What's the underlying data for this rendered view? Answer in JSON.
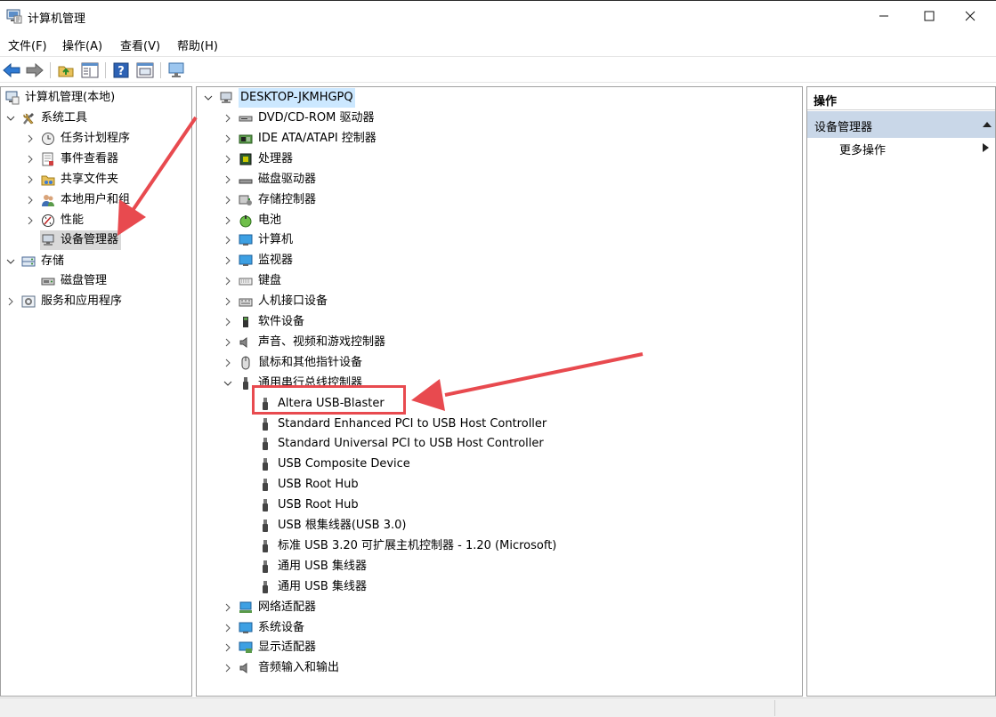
{
  "window": {
    "title": "计算机管理",
    "minimize_glyph": "—",
    "maximize_glyph": "☐",
    "close_glyph": "✕"
  },
  "menu": [
    "文件(F)",
    "操作(A)",
    "查看(V)",
    "帮助(H)"
  ],
  "left_tree": {
    "root": "计算机管理(本地)",
    "system_tools": "系统工具",
    "task_scheduler": "任务计划程序",
    "event_viewer": "事件查看器",
    "shared_folders": "共享文件夹",
    "local_users": "本地用户和组",
    "performance": "性能",
    "device_manager": "设备管理器",
    "storage": "存储",
    "disk_management": "磁盘管理",
    "services_apps": "服务和应用程序"
  },
  "device_tree": {
    "computer_name": "DESKTOP-JKMHGPQ",
    "categories": [
      {
        "label": "DVD/CD-ROM 驱动器",
        "icon": "dvd-drive-icon"
      },
      {
        "label": "IDE ATA/ATAPI 控制器",
        "icon": "ide-controller-icon"
      },
      {
        "label": "处理器",
        "icon": "processor-icon"
      },
      {
        "label": "磁盘驱动器",
        "icon": "disk-drive-icon"
      },
      {
        "label": "存储控制器",
        "icon": "storage-controller-icon"
      },
      {
        "label": "电池",
        "icon": "battery-icon"
      },
      {
        "label": "计算机",
        "icon": "computer-icon"
      },
      {
        "label": "监视器",
        "icon": "monitor-icon"
      },
      {
        "label": "键盘",
        "icon": "keyboard-icon"
      },
      {
        "label": "人机接口设备",
        "icon": "hid-icon"
      },
      {
        "label": "软件设备",
        "icon": "software-device-icon"
      },
      {
        "label": "声音、视频和游戏控制器",
        "icon": "sound-icon"
      },
      {
        "label": "鼠标和其他指针设备",
        "icon": "mouse-icon"
      },
      {
        "label": "通用串行总线控制器",
        "icon": "usb-icon"
      }
    ],
    "usb_children": [
      "Altera USB-Blaster",
      "Standard Enhanced PCI to USB Host Controller",
      "Standard Universal PCI to USB Host Controller",
      "USB Composite Device",
      "USB Root Hub",
      "USB Root Hub",
      "USB 根集线器(USB 3.0)",
      "标准 USB 3.20 可扩展主机控制器 - 1.20 (Microsoft)",
      "通用 USB 集线器",
      "通用 USB 集线器"
    ],
    "after_categories": [
      {
        "label": "网络适配器",
        "icon": "network-adapter-icon"
      },
      {
        "label": "系统设备",
        "icon": "system-device-icon"
      },
      {
        "label": "显示适配器",
        "icon": "display-adapter-icon"
      },
      {
        "label": "音频输入和输出",
        "icon": "audio-io-icon"
      }
    ]
  },
  "actions": {
    "header": "操作",
    "section": "设备管理器",
    "more": "更多操作"
  },
  "colors": {
    "annotation_red": "#e84a4f",
    "selection_gray": "#d9d9d9",
    "action_section_bg": "#c9d7e8",
    "computer_highlight": "#cce8ff"
  }
}
